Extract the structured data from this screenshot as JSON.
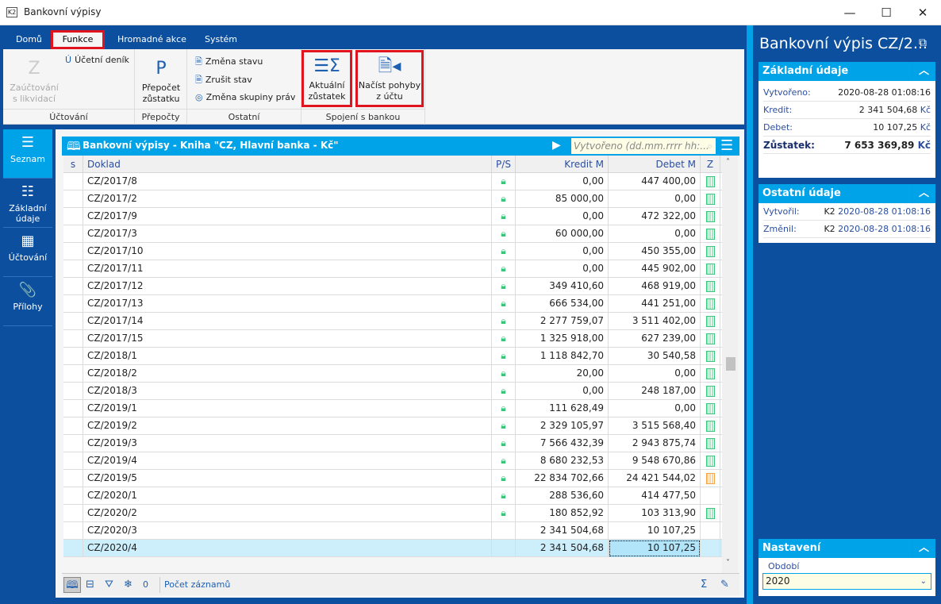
{
  "window": {
    "title": "Bankovní výpisy",
    "minimize": "—",
    "maximize": "☐",
    "close": "✕"
  },
  "tabs": [
    {
      "label": "Domů"
    },
    {
      "label": "Funkce",
      "active": true
    },
    {
      "label": "Hromadné akce"
    },
    {
      "label": "Systém"
    }
  ],
  "ribbon": {
    "groups": [
      {
        "label": "Účtování",
        "buttons": [
          {
            "label1": "Zaúčtování",
            "label2": "s likvidací",
            "icon": "Z",
            "disabled": true
          },
          {
            "label": "Účetní deník",
            "icon": "Ú"
          }
        ]
      },
      {
        "label": "Přepočty",
        "buttons": [
          {
            "label1": "Přepočet",
            "label2": "zůstatku",
            "icon": "P"
          }
        ]
      },
      {
        "label": "Ostatní",
        "buttons": [
          {
            "label": "Změna stavu"
          },
          {
            "label": "Zrušit stav"
          },
          {
            "label": "Změna skupiny práv"
          }
        ]
      },
      {
        "label": "Spojení s bankou",
        "buttons": [
          {
            "label1": "Aktuální",
            "label2": "zůstatek",
            "icon": "list-sigma"
          },
          {
            "label1": "Načíst pohyby",
            "label2": "z účtu",
            "icon": "document-import"
          }
        ]
      }
    ]
  },
  "leftnav": [
    {
      "label": "Seznam",
      "active": true
    },
    {
      "label": "Základní údaje"
    },
    {
      "label": "Účtování"
    },
    {
      "label": "Přílohy"
    }
  ],
  "grid": {
    "title": "Bankovní výpisy - Kniha \"CZ, Hlavní banka - Kč\"",
    "search_placeholder": "Vytvořeno (dd.mm.rrrr hh:...",
    "columns": [
      "s",
      "Doklad",
      "P/S",
      "Kredit M",
      "Debet M",
      "Z"
    ],
    "rows": [
      {
        "doklad": "CZ/2017/8",
        "locked": true,
        "kredit": "0,00",
        "debet": "447 400,00",
        "z": "green"
      },
      {
        "doklad": "CZ/2017/2",
        "locked": true,
        "kredit": "85 000,00",
        "debet": "0,00",
        "z": "green"
      },
      {
        "doklad": "CZ/2017/9",
        "locked": true,
        "kredit": "0,00",
        "debet": "472 322,00",
        "z": "green"
      },
      {
        "doklad": "CZ/2017/3",
        "locked": true,
        "kredit": "60 000,00",
        "debet": "0,00",
        "z": "green"
      },
      {
        "doklad": "CZ/2017/10",
        "locked": true,
        "kredit": "0,00",
        "debet": "450 355,00",
        "z": "green"
      },
      {
        "doklad": "CZ/2017/11",
        "locked": true,
        "kredit": "0,00",
        "debet": "445 902,00",
        "z": "green"
      },
      {
        "doklad": "CZ/2017/12",
        "locked": true,
        "kredit": "349 410,60",
        "debet": "468 919,00",
        "z": "green"
      },
      {
        "doklad": "CZ/2017/13",
        "locked": true,
        "kredit": "666 534,00",
        "debet": "441 251,00",
        "z": "green"
      },
      {
        "doklad": "CZ/2017/14",
        "locked": true,
        "kredit": "2 277 759,07",
        "debet": "3 511 402,00",
        "z": "green"
      },
      {
        "doklad": "CZ/2017/15",
        "locked": true,
        "kredit": "1 325 918,00",
        "debet": "627 239,00",
        "z": "green"
      },
      {
        "doklad": "CZ/2018/1",
        "locked": true,
        "kredit": "1 118 842,70",
        "debet": "30 540,58",
        "z": "green"
      },
      {
        "doklad": "CZ/2018/2",
        "locked": true,
        "kredit": "20,00",
        "debet": "0,00",
        "z": "green"
      },
      {
        "doklad": "CZ/2018/3",
        "locked": true,
        "kredit": "0,00",
        "debet": "248 187,00",
        "z": "green"
      },
      {
        "doklad": "CZ/2019/1",
        "locked": true,
        "kredit": "111 628,49",
        "debet": "0,00",
        "z": "green"
      },
      {
        "doklad": "CZ/2019/2",
        "locked": true,
        "kredit": "2 329 105,97",
        "debet": "3 515 568,40",
        "z": "green"
      },
      {
        "doklad": "CZ/2019/3",
        "locked": true,
        "kredit": "7 566 432,39",
        "debet": "2 943 875,74",
        "z": "green"
      },
      {
        "doklad": "CZ/2019/4",
        "locked": true,
        "kredit": "8 680 232,53",
        "debet": "9 548 670,86",
        "z": "green"
      },
      {
        "doklad": "CZ/2019/5",
        "locked": true,
        "kredit": "22 834 702,66",
        "debet": "24 421 544,02",
        "z": "orange"
      },
      {
        "doklad": "CZ/2020/1",
        "locked": true,
        "kredit": "288 536,60",
        "debet": "414 477,50",
        "z": ""
      },
      {
        "doklad": "CZ/2020/2",
        "locked": true,
        "kredit": "180 852,92",
        "debet": "103 313,90",
        "z": "green"
      },
      {
        "doklad": "CZ/2020/3",
        "locked": false,
        "kredit": "2 341 504,68",
        "debet": "10 107,25",
        "z": ""
      },
      {
        "doklad": "CZ/2020/4",
        "locked": false,
        "kredit": "2 341 504,68",
        "debet": "10 107,25",
        "z": "",
        "selected": true
      }
    ],
    "footer": {
      "filter_count": "0",
      "record_count_label": "Počet záznamů"
    }
  },
  "detail": {
    "title": "Bankovní výpis CZ/2...",
    "basic": {
      "header": "Základní údaje",
      "rows": [
        {
          "label": "Vytvořeno:",
          "value": "2020-08-28 01:08:16"
        },
        {
          "label": "Kredit:",
          "value": "2 341 504,68",
          "currency": "Kč"
        },
        {
          "label": "Debet:",
          "value": "10 107,25",
          "currency": "Kč"
        },
        {
          "label": "Zůstatek:",
          "value": "7 653 369,89",
          "currency": "Kč",
          "bold": true
        }
      ]
    },
    "other": {
      "header": "Ostatní údaje",
      "rows": [
        {
          "label": "Vytvořil:",
          "user": "K2",
          "value": "2020-08-28 01:08:16"
        },
        {
          "label": "Změnil:",
          "user": "K2",
          "value": "2020-08-28 01:08:16"
        }
      ]
    },
    "settings": {
      "header": "Nastavení",
      "period_label": "Období",
      "period_value": "2020"
    }
  },
  "colors": {
    "frame": "#0c4f9e",
    "accent": "#00a2e8",
    "highlight": "#e0141e",
    "lock": "#3cc47c",
    "selected_row": "#cdeefb"
  }
}
